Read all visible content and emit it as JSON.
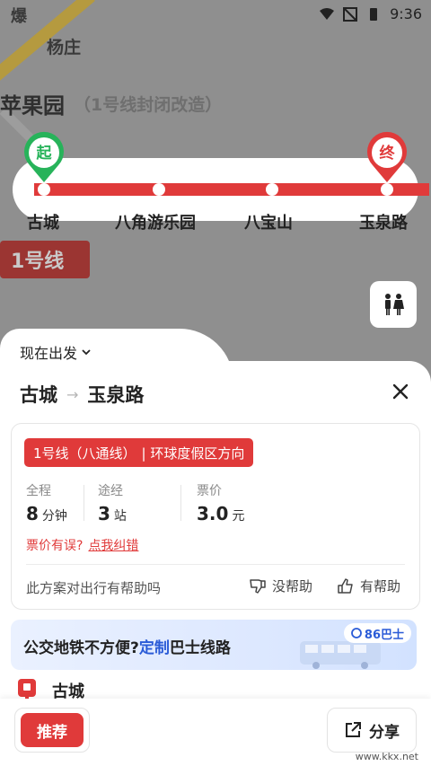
{
  "status_bar": {
    "time": "9:36"
  },
  "map": {
    "corner_label": "爆",
    "station_yangzhuang": "杨庄",
    "station_pingguoyuan": "苹果园",
    "pingguoyuan_note": "（1号线封闭改造）",
    "line_badge": "1号线",
    "start_pin": "起",
    "end_pin": "终",
    "stops": [
      "古城",
      "八角游乐园",
      "八宝山",
      "玉泉路"
    ]
  },
  "sheet": {
    "depart_label": "现在出发",
    "origin": "古城",
    "destination": "玉泉路"
  },
  "card": {
    "line_name": "1号线（八通线）",
    "direction": "| 环球度假区方向",
    "stats": [
      {
        "label": "全程",
        "value": "8",
        "unit": "分钟"
      },
      {
        "label": "途经",
        "value": "3",
        "unit": "站"
      },
      {
        "label": "票价",
        "value": "3.0",
        "unit": "元"
      }
    ],
    "fare_error": "票价有误?",
    "fare_link": "点我纠错",
    "feedback_question": "此方案对出行有帮助吗",
    "not_helpful": "没帮助",
    "helpful": "有帮助"
  },
  "banner": {
    "text_before": "公交地铁不方便?",
    "text_highlight": "定制",
    "text_after": "巴士线路",
    "logo": "86巴士"
  },
  "first_stop": "古城",
  "bottom": {
    "recommend": "推荐",
    "share": "分享",
    "watermark": "www.kkx.net"
  },
  "colors": {
    "accent": "#e03a3a",
    "start_green": "#27b35a",
    "link_blue": "#2a5bd7"
  }
}
